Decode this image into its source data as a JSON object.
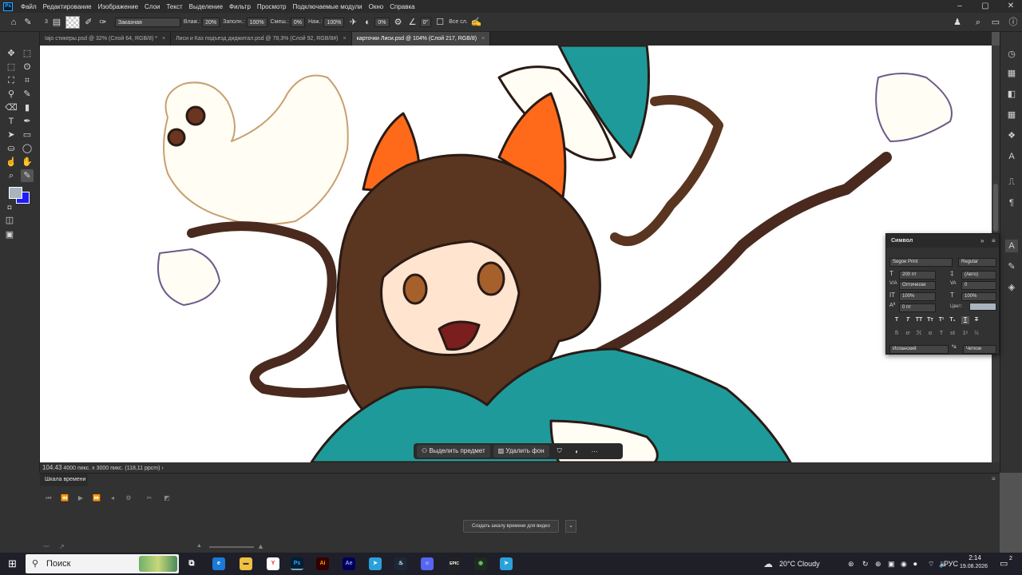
{
  "app": {
    "logo": "Ps"
  },
  "menu": [
    "Файл",
    "Редактирование",
    "Изображение",
    "Слои",
    "Текст",
    "Выделение",
    "Фильтр",
    "Просмотр",
    "Подключаемые модули",
    "Окно",
    "Справка"
  ],
  "options": {
    "brush_size": "3",
    "mode": "Заказная",
    "wetness_label": "Влаж.:",
    "wetness": "20%",
    "load_label": "Заполн.:",
    "load": "100%",
    "mix_label": "Смеш.:",
    "mix": "0%",
    "pressure_label": "Наж.:",
    "pressure": "100%",
    "smoothing": "0%",
    "angle": "0°",
    "all_layers": "Все сл."
  },
  "tabs": [
    {
      "label": "Iajo стикеры.psd @ 32% (Слой 64, RGB/8) *",
      "active": false
    },
    {
      "label": "Лиси и Каз подъезд диджитал.psd @ 78,3% (Слой 92, RGB/8#)",
      "active": false
    },
    {
      "label": "карточки Лиси.psd @ 104% (Слой 217, RGB/8)",
      "active": true
    }
  ],
  "status": {
    "zoom": "104.43",
    "doc_info": "4000 пикс. x 3000 пикс. (118,11 ppcm)"
  },
  "context_bar": {
    "select_subject": "Выделить предмет",
    "remove_bg": "Удалить фон"
  },
  "symbol_panel": {
    "title": "Символ",
    "font": "Segoe Print",
    "style": "Regular",
    "size": "200 пт",
    "leading": "(Авто)",
    "kerning": "Оптически",
    "tracking": "0",
    "vscale": "100%",
    "hscale": "100%",
    "baseline": "0 пт",
    "color_label": "Цвет:",
    "language": "Испанский",
    "antialias": "Четкое"
  },
  "timeline": {
    "title": "Шкала времени",
    "create_button": "Создать шкалу времени для видео"
  },
  "taskbar": {
    "search": "Поиск",
    "weather": "20°C  Cloudy",
    "lang": "РУС",
    "time": "2:14",
    "date": "19.08.2026",
    "notif": "2"
  },
  "colors": {
    "foreground": "#aab3c0",
    "background": "#1a1aff",
    "teal": "#1f9a9a",
    "hair": "#5a3520",
    "orange": "#ff6a1a"
  }
}
